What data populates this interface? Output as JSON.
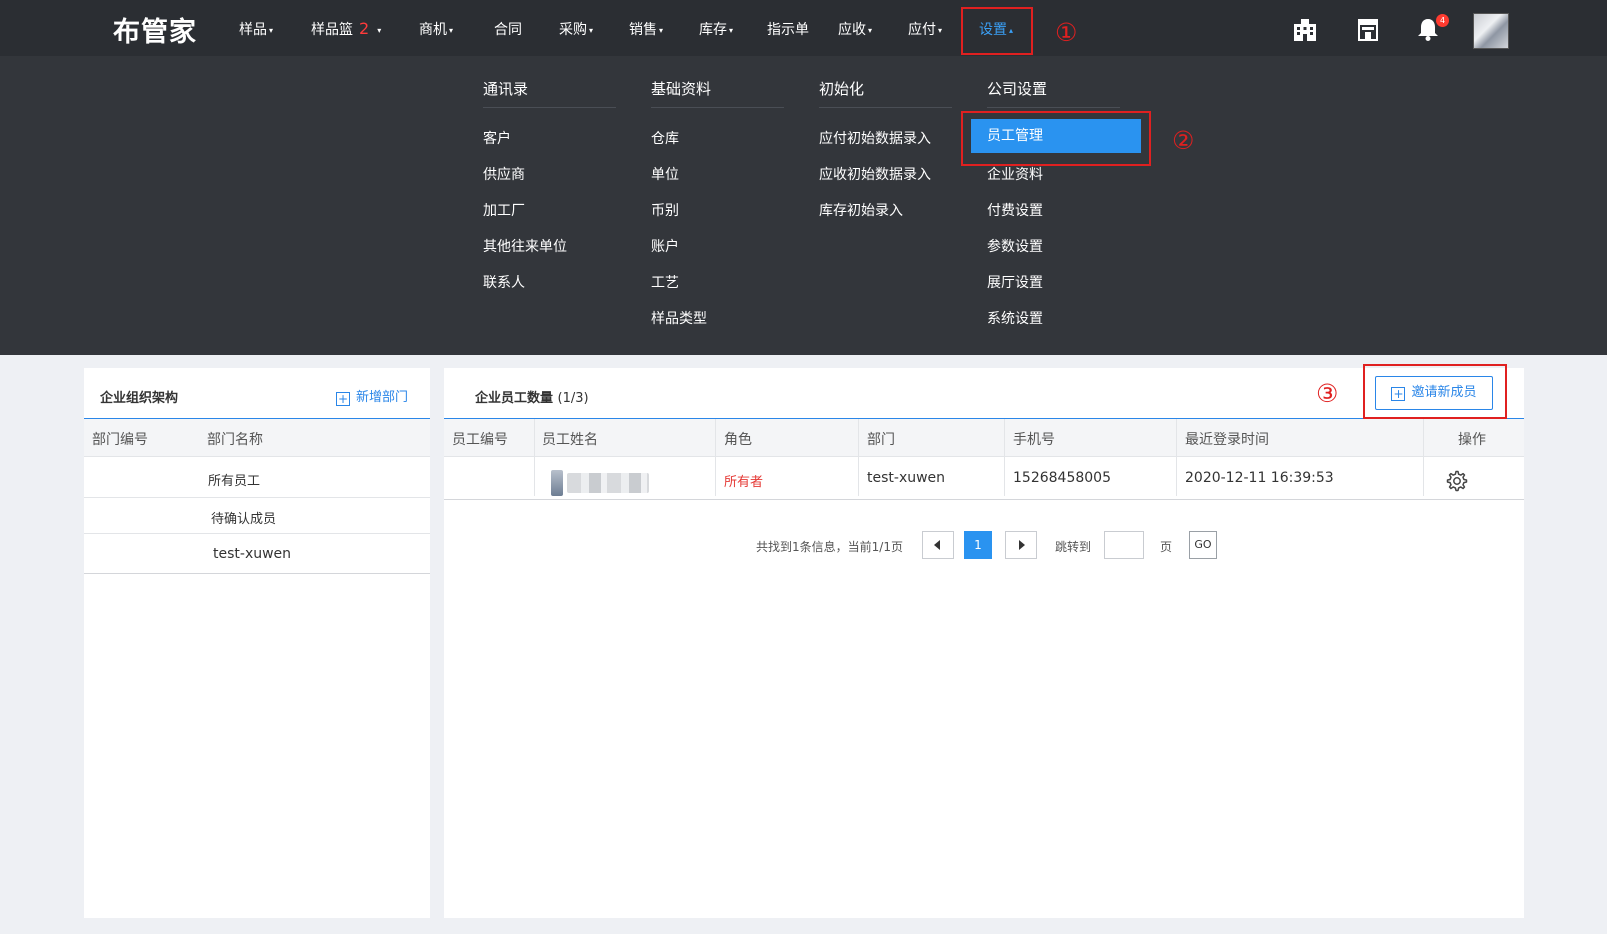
{
  "app": {
    "logo": "布管家"
  },
  "nav": {
    "items": [
      {
        "label": "样品",
        "caret": "▾"
      },
      {
        "label": "样品篮",
        "badge": "2",
        "caret": "▾"
      },
      {
        "label": "商机",
        "caret": "▾"
      },
      {
        "label": "合同",
        "caret": ""
      },
      {
        "label": "采购",
        "caret": "▾"
      },
      {
        "label": "销售",
        "caret": "▾"
      },
      {
        "label": "库存",
        "caret": "▾"
      },
      {
        "label": "指示单",
        "caret": ""
      },
      {
        "label": "应收",
        "caret": "▾"
      },
      {
        "label": "应付",
        "caret": "▾"
      },
      {
        "label": "设置",
        "caret": "▴",
        "active": true
      }
    ],
    "icons": [
      "building-icon",
      "shop-icon",
      "bell-icon",
      "avatar"
    ],
    "bell_badge": "4"
  },
  "dropdown": {
    "columns": [
      {
        "title": "通讯录",
        "items": [
          "客户",
          "供应商",
          "加工厂",
          "其他往来单位",
          "联系人"
        ]
      },
      {
        "title": "基础资料",
        "items": [
          "仓库",
          "单位",
          "币别",
          "账户",
          "工艺",
          "样品类型"
        ]
      },
      {
        "title": "初始化",
        "items": [
          "应付初始数据录入",
          "应收初始数据录入",
          "库存初始录入"
        ]
      },
      {
        "title": "公司设置",
        "items": [
          "员工管理",
          "企业资料",
          "付费设置",
          "参数设置",
          "展厅设置",
          "系统设置"
        ],
        "selected_index": 0
      }
    ]
  },
  "annotations": {
    "n1": "①",
    "n2": "②",
    "n3": "③"
  },
  "left_panel": {
    "title": "企业组织架构",
    "add_label": "新增部门",
    "columns": [
      "部门编号",
      "部门名称"
    ],
    "departments": [
      "所有员工",
      "待确认成员",
      "test-xuwen"
    ]
  },
  "right_panel": {
    "title": "企业员工数量",
    "count": "(1/3)",
    "invite_label": "邀请新成员",
    "columns": [
      "员工编号",
      "员工姓名",
      "角色",
      "部门",
      "手机号",
      "最近登录时间",
      "操作"
    ],
    "rows": [
      {
        "id": "",
        "name": "",
        "role": "所有者",
        "dept": "test-xuwen",
        "phone": "15268458005",
        "last_login": "2020-12-11 16:39:53"
      }
    ],
    "pagination": {
      "summary": "共找到1条信息，当前1/1页",
      "current_page": "1",
      "jump_label": "跳转到",
      "page_unit": "页",
      "go_label": "GO",
      "jump_value": ""
    }
  },
  "colors": {
    "accent": "#2a93f0",
    "topbar": "#2b2e33",
    "dropdown": "#33363b",
    "annotation": "#e02020",
    "owner": "#e53935"
  }
}
